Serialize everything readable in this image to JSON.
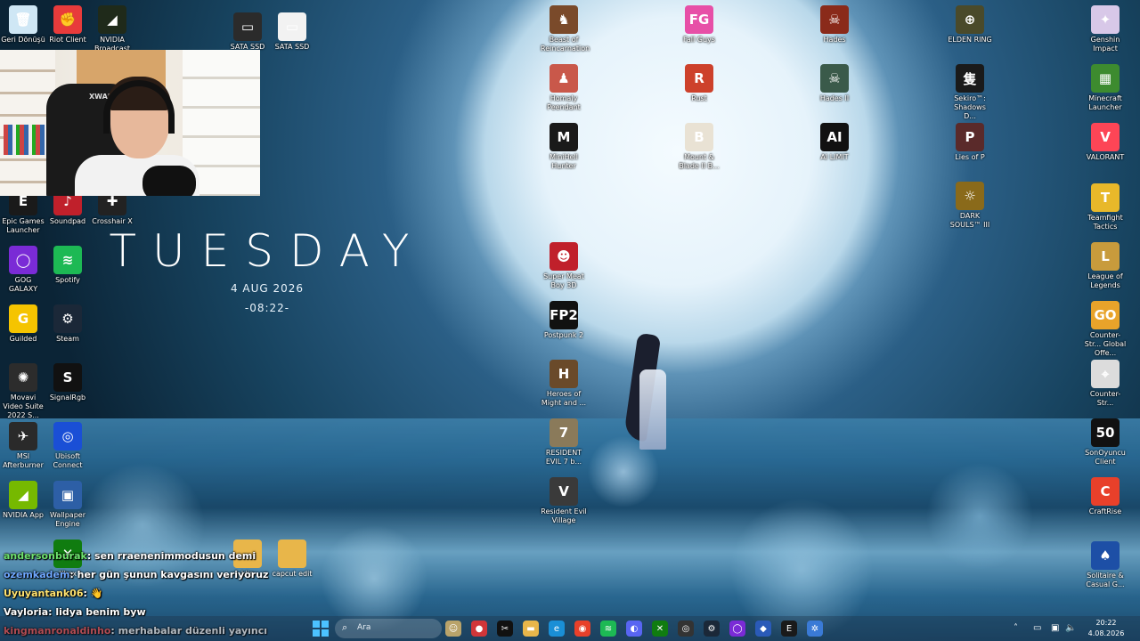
{
  "desktop": {
    "widget": {
      "day": "TUESDAY",
      "date": "4 AUG 2026",
      "time": "-08:22-"
    },
    "left_icons": [
      {
        "label": "Geri Dönüşü",
        "icon": "recycle-bin-icon",
        "color": "#cfe7f5",
        "glyph": "🗑"
      },
      {
        "label": "Riot Client",
        "icon": "riot-client-icon",
        "color": "#e83b3b",
        "glyph": "✊"
      },
      {
        "label": "NVIDIA Broadcast",
        "icon": "nvidia-broadcast-icon",
        "color": "#1f2a1a",
        "glyph": "◢"
      },
      {
        "label": "SATA SSD",
        "icon": "drive-icon",
        "color": "#2b2b2b",
        "glyph": "▭"
      },
      {
        "label": "SATA SSD",
        "icon": "drive-icon",
        "color": "#f2f2f2",
        "glyph": "▭"
      },
      {
        "label": "Epic Games Launcher",
        "icon": "epic-games-icon",
        "color": "#1a1a1a",
        "glyph": "E"
      },
      {
        "label": "Soundpad",
        "icon": "soundpad-icon",
        "color": "#c0202b",
        "glyph": "♪"
      },
      {
        "label": "Crosshair X",
        "icon": "crosshair-icon",
        "color": "#222",
        "glyph": "✚"
      },
      {
        "label": "GOG GALAXY",
        "icon": "gog-galaxy-icon",
        "color": "#7a2bd6",
        "glyph": "◯"
      },
      {
        "label": "Spotify",
        "icon": "spotify-icon",
        "color": "#1db954",
        "glyph": "≋"
      },
      {
        "label": "Guilded",
        "icon": "guilded-icon",
        "color": "#f5c400",
        "glyph": "G"
      },
      {
        "label": "Steam",
        "icon": "steam-icon",
        "color": "#1b2838",
        "glyph": "⚙"
      },
      {
        "label": "Movavi Video Suite 2022 S...",
        "icon": "movavi-icon",
        "color": "#2c2c2c",
        "glyph": "✺"
      },
      {
        "label": "SignalRgb",
        "icon": "signalrgb-icon",
        "color": "#111",
        "glyph": "S"
      },
      {
        "label": "MSI Afterburner",
        "icon": "msi-afterburner-icon",
        "color": "#2a2a2a",
        "glyph": "✈"
      },
      {
        "label": "Ubisoft Connect",
        "icon": "ubisoft-icon",
        "color": "#1a4fd6",
        "glyph": "◎"
      },
      {
        "label": "NVIDIA App",
        "icon": "nvidia-app-icon",
        "color": "#76b900",
        "glyph": "◢"
      },
      {
        "label": "Wallpaper Engine",
        "icon": "wallpaper-engine-icon",
        "color": "#2d5fa6",
        "glyph": "▣"
      },
      {
        "label": "Xbox",
        "icon": "xbox-icon",
        "color": "#107c10",
        "glyph": "✕"
      },
      {
        "label": "klip",
        "icon": "folder-icon",
        "color": "#e8b64a",
        "glyph": ""
      },
      {
        "label": "capcut edit",
        "icon": "folder-icon",
        "color": "#e8b64a",
        "glyph": ""
      }
    ],
    "middle_icons": [
      {
        "label": "Beast of Reincarnation",
        "icon": "game-icon",
        "color": "#7a4a2a",
        "glyph": "♞"
      },
      {
        "label": "Fall Guys",
        "icon": "fall-guys-icon",
        "color": "#e74fa7",
        "glyph": "FG"
      },
      {
        "label": "Hades",
        "icon": "hades-icon",
        "color": "#8a2a1a",
        "glyph": "☠"
      },
      {
        "label": "Homaly Peendant",
        "icon": "game-icon",
        "color": "#c9584a",
        "glyph": "♟"
      },
      {
        "label": "Rust",
        "icon": "rust-icon",
        "color": "#cd412b",
        "glyph": "R"
      },
      {
        "label": "Hades II",
        "icon": "hades-ii-icon",
        "color": "#3a5a4a",
        "glyph": "☠"
      },
      {
        "label": "MiniHell Hunter",
        "icon": "game-icon",
        "color": "#1a1a1a",
        "glyph": "M"
      },
      {
        "label": "Mount & Blade II B...",
        "icon": "mount-blade-icon",
        "color": "#e9e2d4",
        "glyph": "B"
      },
      {
        "label": "AI LIMIT",
        "icon": "ai-limit-icon",
        "color": "#111",
        "glyph": "AI"
      },
      {
        "label": "Super Meat Boy 3D",
        "icon": "super-meat-boy-icon",
        "color": "#c0202b",
        "glyph": "☻"
      },
      {
        "label": "Postpunk 2",
        "icon": "fp2-icon",
        "color": "#111",
        "glyph": "FP2"
      },
      {
        "label": "Heroes of Might and ...",
        "icon": "heroes-icon",
        "color": "#6a4a2a",
        "glyph": "H"
      },
      {
        "label": "RESIDENT EVIL 7 b...",
        "icon": "re7-icon",
        "color": "#8a7a5a",
        "glyph": "7"
      },
      {
        "label": "Resident Evil Village",
        "icon": "re-village-icon",
        "color": "#3a3a3a",
        "glyph": "V"
      }
    ],
    "right_icons": [
      {
        "label": "ELDEN RING",
        "icon": "elden-ring-icon",
        "color": "#4a4a2a",
        "glyph": "⊕"
      },
      {
        "label": "Genshin Impact",
        "icon": "genshin-icon",
        "color": "#d8c8e8",
        "glyph": "✦"
      },
      {
        "label": "Sekiro™: Shadows D...",
        "icon": "sekiro-icon",
        "color": "#1a1a1a",
        "glyph": "隻"
      },
      {
        "label": "Minecraft Launcher",
        "icon": "minecraft-icon",
        "color": "#3d8b2f",
        "glyph": "▦"
      },
      {
        "label": "Lies of P",
        "icon": "lies-of-p-icon",
        "color": "#5a2a2a",
        "glyph": "P"
      },
      {
        "label": "VALORANT",
        "icon": "valorant-icon",
        "color": "#fd4556",
        "glyph": "V"
      },
      {
        "label": "DARK SOULS™ III",
        "icon": "dark-souls-icon",
        "color": "#8a6a1a",
        "glyph": "☼"
      },
      {
        "label": "Teamfight Tactics",
        "icon": "tft-icon",
        "color": "#e8b82a",
        "glyph": "T"
      },
      {
        "label": "League of Legends",
        "icon": "lol-icon",
        "color": "#c89b3c",
        "glyph": "L"
      },
      {
        "label": "Counter-Str... Global Offe...",
        "icon": "csgo-icon",
        "color": "#e8a32a",
        "glyph": "GO"
      },
      {
        "label": "Counter-Str...",
        "icon": "cs2-icon",
        "color": "#dcdcdc",
        "glyph": "⌖"
      },
      {
        "label": "SonOyuncu Client",
        "icon": "sonoyuncu-icon",
        "color": "#111",
        "glyph": "50"
      },
      {
        "label": "CraftRise",
        "icon": "craftrise-icon",
        "color": "#e8402a",
        "glyph": "C"
      },
      {
        "label": "Solitaire & Casual G...",
        "icon": "solitaire-icon",
        "color": "#1d4fa6",
        "glyph": "♠"
      }
    ]
  },
  "chat": [
    {
      "user": "andersonburak",
      "msg": ": sen rraenenimmodusun demi"
    },
    {
      "user": "ozemkadem",
      "msg": ": her gün şunun kavgasını veriyoruz"
    },
    {
      "user": "Uyuyantank06",
      "msg": ": 👋"
    },
    {
      "user": "Vayloria",
      "msg": ": lidya benim byw"
    },
    {
      "user": "kingmanronaldinho",
      "msg": ": merhabalar düzenli yayıncı"
    }
  ],
  "taskbar": {
    "search_placeholder": "Ara",
    "apps": [
      {
        "icon": "copilot-icon",
        "color": "#b9a36a",
        "glyph": "☺"
      },
      {
        "icon": "riot-icon",
        "color": "#d13639",
        "glyph": "●"
      },
      {
        "icon": "capcut-icon",
        "color": "#111",
        "glyph": "✂"
      },
      {
        "icon": "file-explorer-icon",
        "color": "#e8b64a",
        "glyph": "▬"
      },
      {
        "icon": "edge-icon",
        "color": "#1a8fd6",
        "glyph": "e"
      },
      {
        "icon": "chrome-icon",
        "color": "#e8402a",
        "glyph": "◉"
      },
      {
        "icon": "spotify-icon",
        "color": "#1db954",
        "glyph": "≋"
      },
      {
        "icon": "discord-icon",
        "color": "#5865f2",
        "glyph": "◐"
      },
      {
        "icon": "xbox-icon",
        "color": "#107c10",
        "glyph": "✕"
      },
      {
        "icon": "obs-icon",
        "color": "#333",
        "glyph": "◎"
      },
      {
        "icon": "steam-icon",
        "color": "#1b2838",
        "glyph": "⚙"
      },
      {
        "icon": "gog-icon",
        "color": "#7a2bd6",
        "glyph": "◯"
      },
      {
        "icon": "game-icon",
        "color": "#2a5ab8",
        "glyph": "◆"
      },
      {
        "icon": "epic-icon",
        "color": "#1a1a1a",
        "glyph": "E"
      },
      {
        "icon": "network-app-icon",
        "color": "#3a7ad6",
        "glyph": "✲"
      }
    ],
    "clock_time": "20:22",
    "clock_date": "4.08.2026"
  }
}
